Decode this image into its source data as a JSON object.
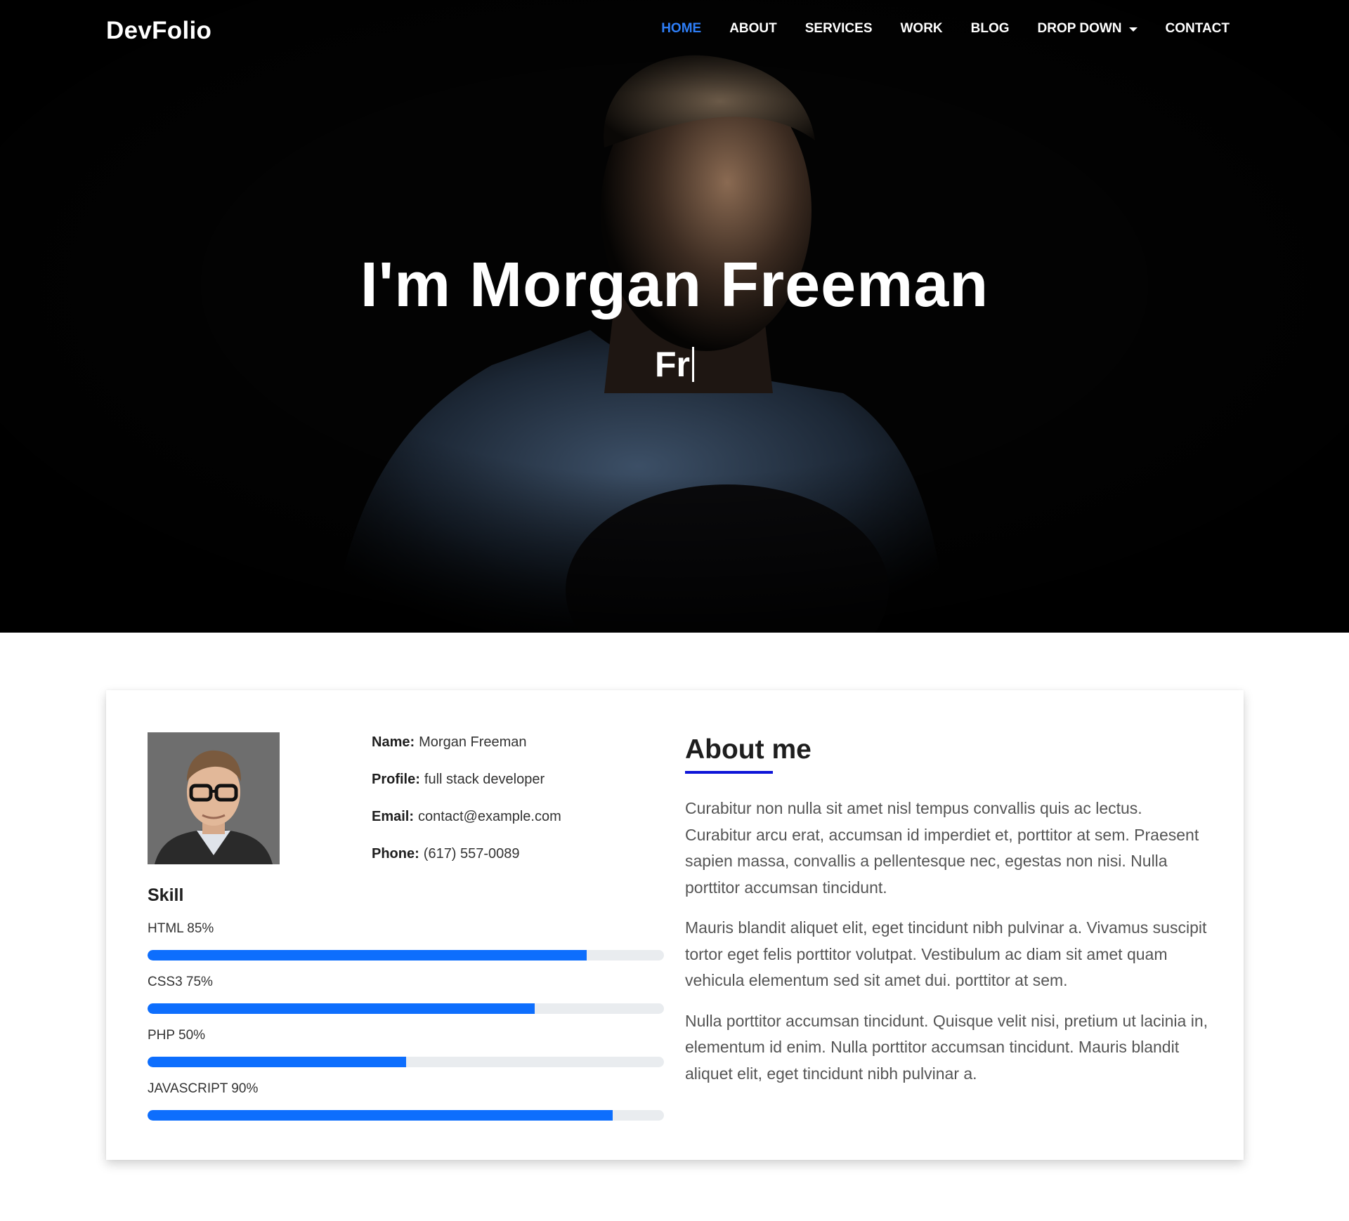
{
  "header": {
    "brand": "DevFolio",
    "nav": [
      {
        "label": "HOME",
        "active": true
      },
      {
        "label": "ABOUT",
        "active": false
      },
      {
        "label": "SERVICES",
        "active": false
      },
      {
        "label": "WORK",
        "active": false
      },
      {
        "label": "BLOG",
        "active": false
      },
      {
        "label": "DROP DOWN",
        "active": false,
        "has_caret": true
      },
      {
        "label": "CONTACT",
        "active": false
      }
    ],
    "accent_color": "#2e7ef7"
  },
  "hero": {
    "title": "I'm Morgan Freeman",
    "typed_text": "Fr"
  },
  "about": {
    "info": [
      {
        "label": "Name:",
        "value": "Morgan Freeman"
      },
      {
        "label": "Profile:",
        "value": "full stack developer"
      },
      {
        "label": "Email:",
        "value": "contact@example.com"
      },
      {
        "label": "Phone:",
        "value": "(617) 557-0089"
      }
    ],
    "skill_title": "Skill",
    "skills": [
      {
        "label": "HTML 85%",
        "percent": 85
      },
      {
        "label": "CSS3 75%",
        "percent": 75
      },
      {
        "label": "PHP 50%",
        "percent": 50
      },
      {
        "label": "JAVASCRIPT 90%",
        "percent": 90
      }
    ],
    "skill_bar_color": "#0d6efd",
    "title": "About me",
    "paragraphs": [
      "Curabitur non nulla sit amet nisl tempus convallis quis ac lectus. Curabitur arcu erat, accumsan id imperdiet et, porttitor at sem. Praesent sapien massa, convallis a pellentesque nec, egestas non nisi. Nulla porttitor accumsan tincidunt.",
      "Mauris blandit aliquet elit, eget tincidunt nibh pulvinar a. Vivamus suscipit tortor eget felis porttitor volutpat. Vestibulum ac diam sit amet quam vehicula elementum sed sit amet dui. porttitor at sem.",
      "Nulla porttitor accumsan tincidunt. Quisque velit nisi, pretium ut lacinia in, elementum id enim. Nulla porttitor accumsan tincidunt. Mauris blandit aliquet elit, eget tincidunt nibh pulvinar a."
    ]
  }
}
